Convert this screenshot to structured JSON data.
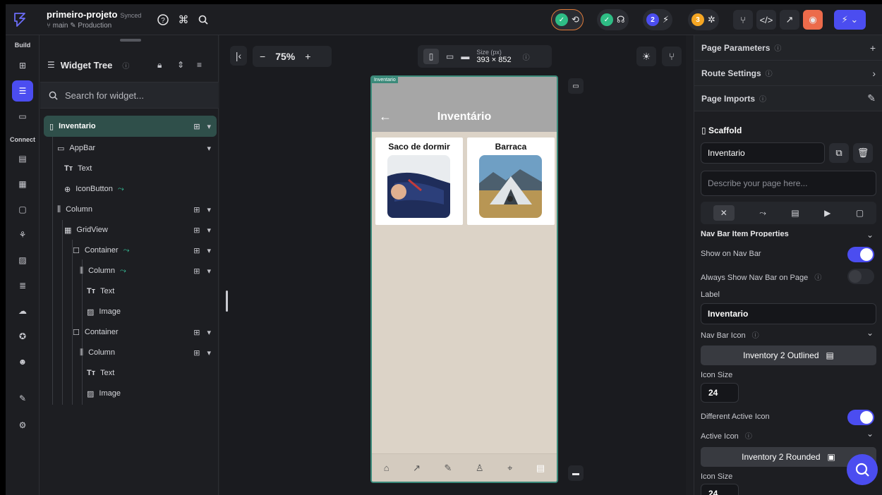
{
  "project": {
    "name": "primeiro-projeto",
    "status": "Synced",
    "branch": "main",
    "environment": "Production",
    "badge_2": "2",
    "badge_3": "3"
  },
  "rail": {
    "build_label": "Build",
    "connect_label": "Connect"
  },
  "tree": {
    "title": "Widget Tree",
    "search_placeholder": "Search for widget...",
    "nodes": [
      {
        "label": "Inventario"
      },
      {
        "label": "AppBar"
      },
      {
        "label": "Text"
      },
      {
        "label": "IconButton"
      },
      {
        "label": "Column"
      },
      {
        "label": "GridView"
      },
      {
        "label": "Container"
      },
      {
        "label": "Column"
      },
      {
        "label": "Text"
      },
      {
        "label": "Image"
      },
      {
        "label": "Container"
      },
      {
        "label": "Column"
      },
      {
        "label": "Text"
      },
      {
        "label": "Image"
      }
    ]
  },
  "canvas": {
    "zoom": "75%",
    "size_label": "Size (px)",
    "size_value": "393 × 852",
    "page_tag": "Inventario",
    "appbar_title": "Inventário",
    "cards": [
      {
        "title": "Saco de dormir"
      },
      {
        "title": "Barraca"
      }
    ]
  },
  "props": {
    "page_parameters": "Page Parameters",
    "route_settings": "Route Settings",
    "page_imports": "Page Imports",
    "scaffold": "Scaffold",
    "page_name": "Inventario",
    "describe_placeholder": "Describe your page here...",
    "nav_section": "Nav Bar Item Properties",
    "show_on_nav": "Show on Nav Bar",
    "always_show": "Always Show Nav Bar on Page",
    "label_caption": "Label",
    "label_value": "Inventario",
    "nav_icon_caption": "Nav Bar Icon",
    "nav_icon_value": "Inventory 2 Outlined",
    "icon_size_caption": "Icon Size",
    "icon_size_value": "24",
    "different_active": "Different Active Icon",
    "active_icon_caption": "Active Icon",
    "active_icon_value": "Inventory 2 Rounded",
    "icon_size_caption_2": "Icon Size",
    "icon_size_value_2": "24"
  },
  "colors": {
    "accent": "#4b4df0",
    "selection": "#2f4f4a",
    "success": "#2ebd85",
    "warning": "#f5a623",
    "page_bg": "#dcd3c7"
  }
}
